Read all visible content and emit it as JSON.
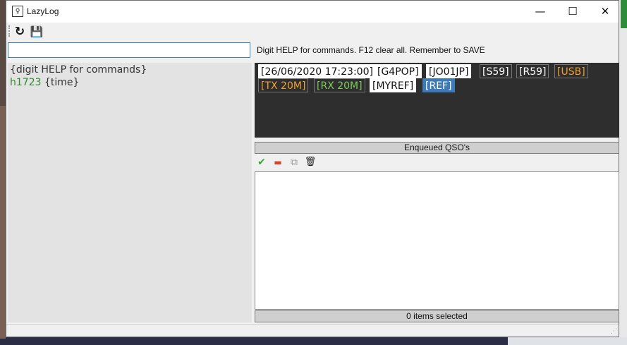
{
  "window": {
    "title": "LazyLog",
    "app_icon_glyph": "♀",
    "minimize_glyph": "—",
    "maximize_glyph": "☐",
    "close_glyph": "✕"
  },
  "toolbar": {
    "refresh_glyph": "↻",
    "save_glyph": "💾"
  },
  "command": {
    "value": "",
    "placeholder": "",
    "hint": "Digit HELP for commands. F12 clear all. Remember to SAVE"
  },
  "left_panel": {
    "line1": "{digit HELP for commands}",
    "line2_code": "h1723",
    "line2_rest": " {time}"
  },
  "tags": {
    "datetime": "[26/06/2020 17:23:00]",
    "callsign": "[G4POP]",
    "locator": "[JO01JP]",
    "rst_sent": "[S59]",
    "rst_rcvd": "[R59]",
    "mode": "[USB]",
    "tx": "[TX 20M]",
    "rx": "[RX 20M]",
    "myref": "[MYREF]",
    "ref": "[REF]"
  },
  "enqueued": {
    "header": "Enqueued QSO's",
    "tools": {
      "confirm_glyph": "✔",
      "remove_glyph": "▬",
      "duplicate_glyph": "⧉",
      "delete_glyph": "🗑"
    },
    "items": [],
    "status": "0 items selected"
  },
  "colors": {
    "tag_panel_bg": "#2e2e2e",
    "tag_orange": "#f0a030",
    "tag_green": "#7dcc5a",
    "tag_blue": "#3d7ab8",
    "code_green": "#2e8b2e"
  }
}
